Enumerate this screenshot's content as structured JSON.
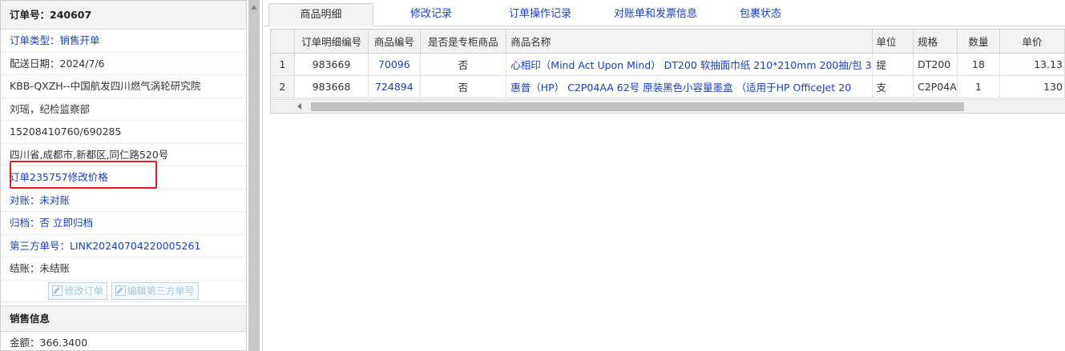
{
  "left": {
    "order_no_header": "订单号：240607",
    "rows": [
      "订单类型：销售开单",
      "配送日期：2024/7/6",
      "KBB-QXZH--中国航发四川燃气涡轮研究院",
      "刘瑶，纪检监察部",
      "15208410760/690285",
      "四川省,成都市,新都区,同仁路520号",
      "订单235757修改价格",
      "对账：未对账",
      "归档：否 立即归档",
      "第三方单号：LINK20240704220005261",
      "结账：未结账"
    ],
    "buttons": {
      "edit_order": "修改订单",
      "edit_third_party": "编辑第三方单号"
    },
    "sales_header": "销售信息",
    "amount": "金额：366.3400"
  },
  "tabs": [
    "商品明细",
    "修改记录",
    "订单操作记录",
    "对账单和发票信息",
    "包裹状态"
  ],
  "grid": {
    "headers": [
      "",
      "订单明细编号",
      "商品编号",
      "是否是专柜商品",
      "商品名称",
      "单位",
      "规格",
      "数量",
      "单价"
    ],
    "rows": [
      [
        "1",
        "983669",
        "70096",
        "否",
        "心相印（Mind Act Upon Mind） DT200 软抽面巾纸 210*210mm 200抽/包 3",
        "提",
        "DT200",
        "18",
        "13.13"
      ],
      [
        "2",
        "983668",
        "724894",
        "否",
        "惠普（HP） C2P04AA 62号 原装黑色小容量墨盒 （适用于HP OfficeJet 20",
        "支",
        "C2P04A",
        "1",
        "130"
      ]
    ]
  },
  "colors": {
    "link": "#1a3fbf",
    "highlight": "#e02020"
  }
}
